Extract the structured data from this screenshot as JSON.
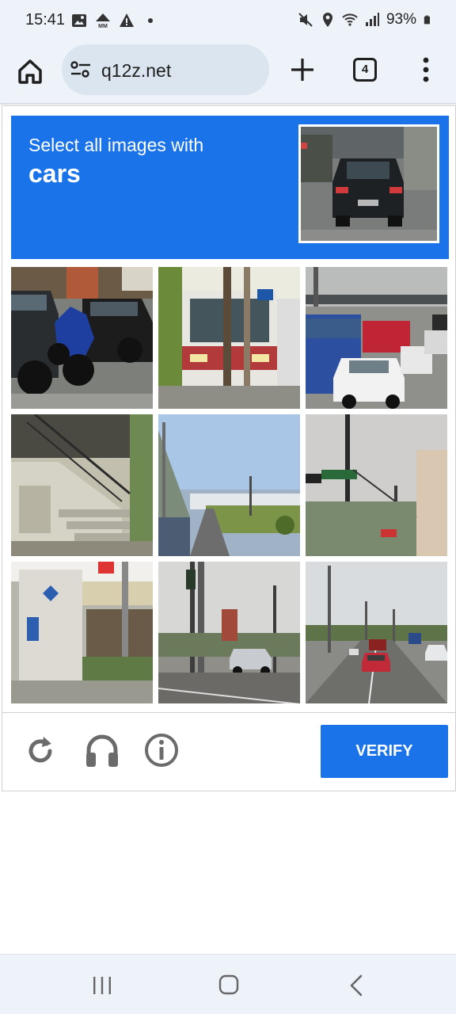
{
  "status_bar": {
    "time": "15:41",
    "left_icons": [
      "image-icon",
      "mm-icon",
      "warning-icon",
      "dot-icon"
    ],
    "right_icons": [
      "mute-icon",
      "location-icon",
      "wifi-icon",
      "signal-icon"
    ],
    "battery": "93%"
  },
  "browser": {
    "url": "q12z.net",
    "tab_count": "4"
  },
  "captcha": {
    "instruction_line": "Select all images with",
    "target": "cars",
    "tiles": [
      {
        "name": "tile-1-parked-car-motorcycle"
      },
      {
        "name": "tile-2-bus"
      },
      {
        "name": "tile-3-traffic-truck"
      },
      {
        "name": "tile-4-stairs"
      },
      {
        "name": "tile-5-road-horizon"
      },
      {
        "name": "tile-6-street-sign"
      },
      {
        "name": "tile-7-building-corner"
      },
      {
        "name": "tile-8-intersection-car"
      },
      {
        "name": "tile-9-highway-cars"
      }
    ],
    "verify_label": "VERIFY",
    "colors": {
      "accent": "#1a73e8"
    }
  }
}
